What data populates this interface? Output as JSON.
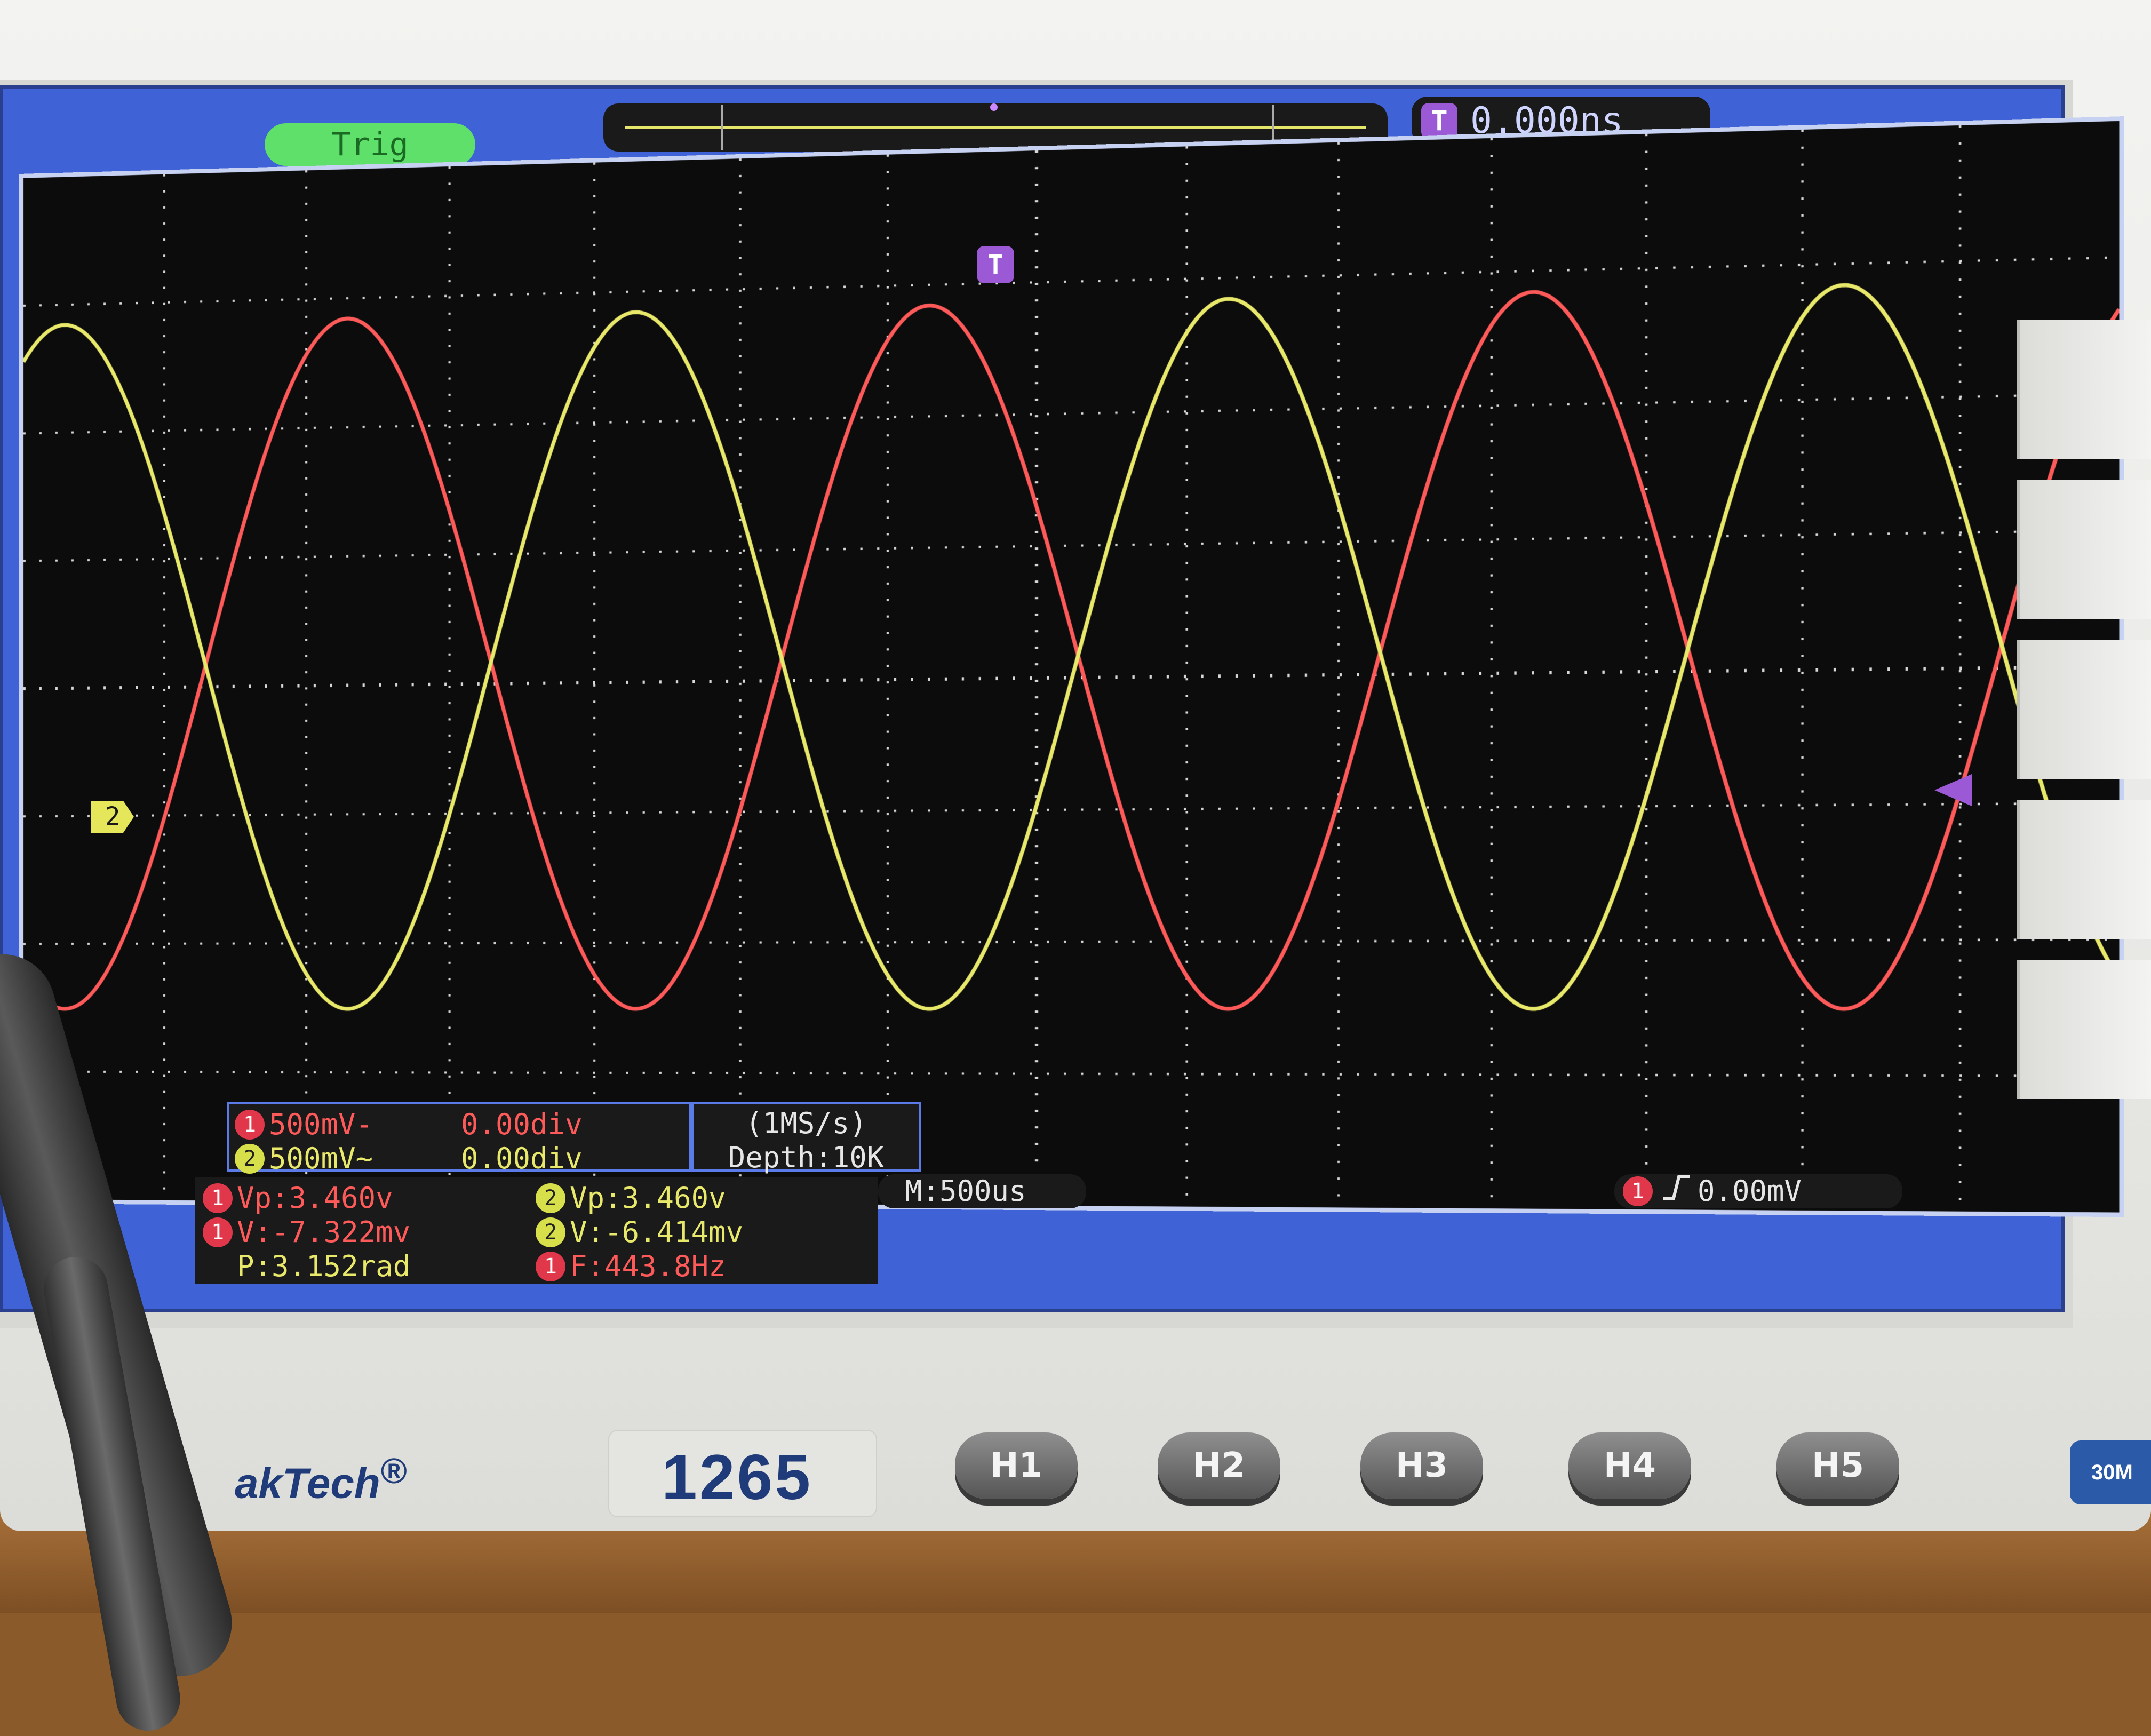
{
  "trigger_status": "Trig",
  "trigger_offset": "0.000ns",
  "trigger_icon_label": "T",
  "ch2_marker_label": "2",
  "channels": [
    {
      "id": "1",
      "scale": "500mV-",
      "offset": "0.00div",
      "color": "#ff5a5a"
    },
    {
      "id": "2",
      "scale": "500mV~",
      "offset": "0.00div",
      "color": "#e8e86a"
    }
  ],
  "acquisition": {
    "rate": "(1MS/s)",
    "depth": "Depth:10K"
  },
  "timebase": "M:500us",
  "trigger_setup": {
    "channel": "1",
    "slope_symbol": "⼽",
    "level": "0.00mV"
  },
  "measurements": [
    {
      "channel": "1",
      "text": "Vp:3.460v"
    },
    {
      "channel": "2",
      "text": "Vp:3.460v"
    },
    {
      "channel": "1",
      "text": "V:-7.322mv"
    },
    {
      "channel": "2",
      "text": "V:-6.414mv"
    },
    {
      "channel": "",
      "text": "P:3.152rad"
    },
    {
      "channel": "1",
      "text": "F:443.8Hz"
    }
  ],
  "brand": "akTech",
  "brand_mark": "®",
  "model": "1265",
  "softkeys": [
    "H1",
    "H2",
    "H3",
    "H4",
    "H5"
  ],
  "badge": "30M"
}
